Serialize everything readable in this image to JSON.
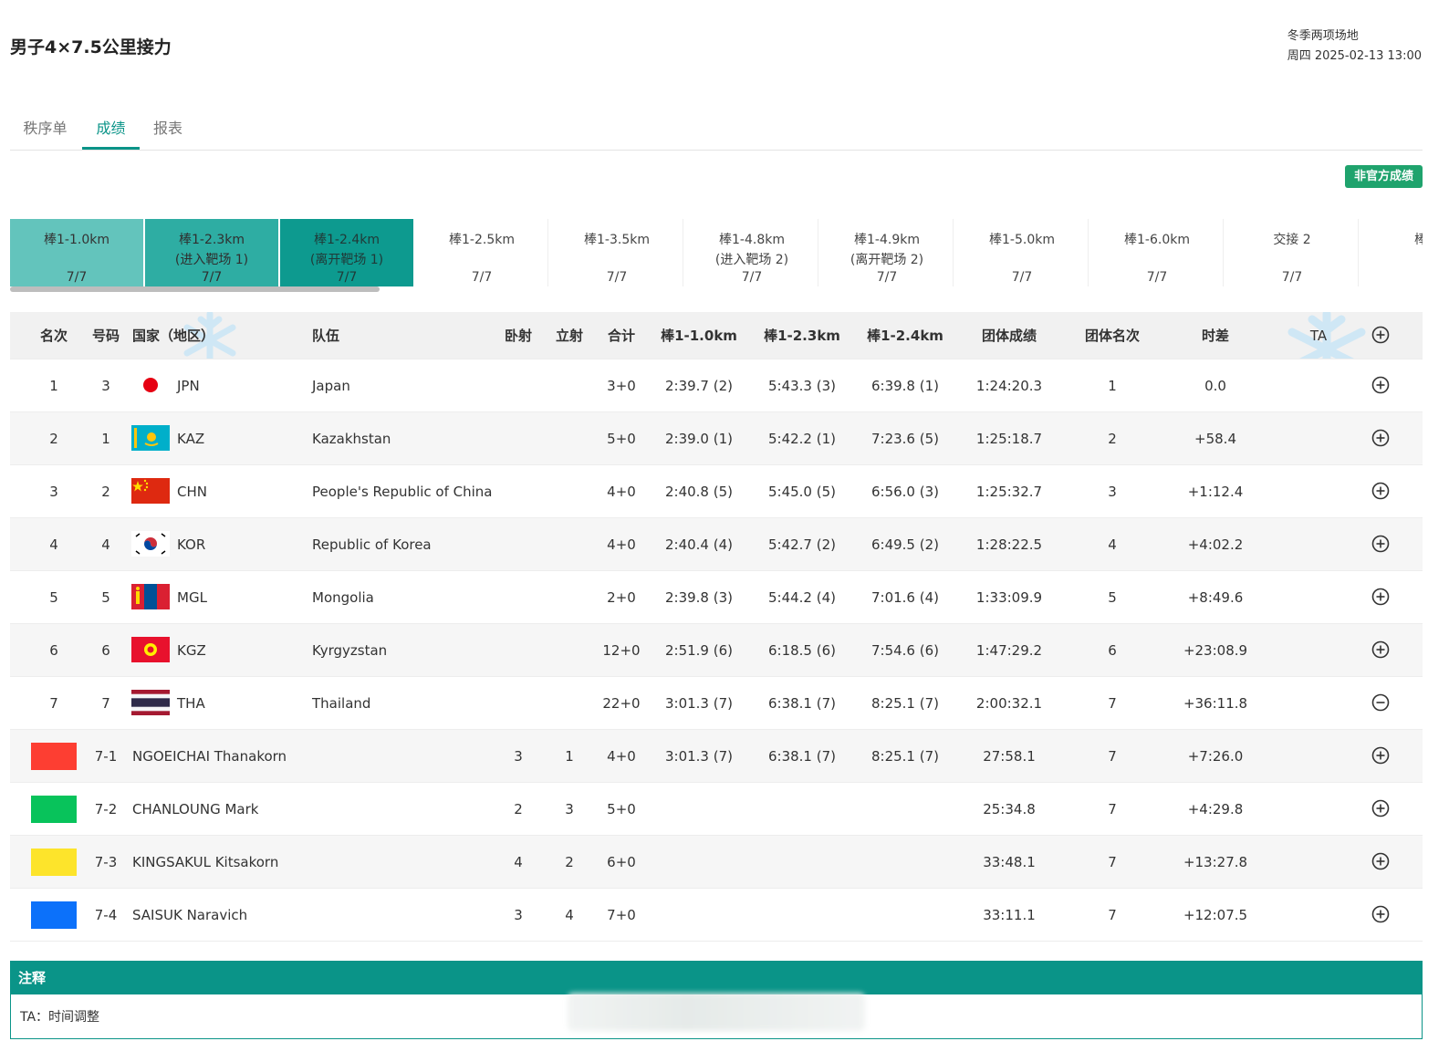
{
  "page": {
    "title": "男子4×7.5公里接力",
    "venue": "冬季两项场地",
    "datetime": "周四 2025-02-13 13:00"
  },
  "tabs": [
    {
      "label": "秩序单"
    },
    {
      "label": "成绩"
    },
    {
      "label": "报表"
    }
  ],
  "active_tab": "成绩",
  "badge": "非官方成绩",
  "splits": [
    {
      "label": "棒1-1.0km",
      "sub": "",
      "count": "7/7"
    },
    {
      "label": "棒1-2.3km",
      "sub": "(进入靶场 1)",
      "count": "7/7"
    },
    {
      "label": "棒1-2.4km",
      "sub": "(离开靶场 1)",
      "count": "7/7"
    },
    {
      "label": "棒1-2.5km",
      "sub": "",
      "count": "7/7"
    },
    {
      "label": "棒1-3.5km",
      "sub": "",
      "count": "7/7"
    },
    {
      "label": "棒1-4.8km",
      "sub": "(进入靶场 2)",
      "count": "7/7"
    },
    {
      "label": "棒1-4.9km",
      "sub": "(离开靶场 2)",
      "count": "7/7"
    },
    {
      "label": "棒1-5.0km",
      "sub": "",
      "count": "7/7"
    },
    {
      "label": "棒1-6.0km",
      "sub": "",
      "count": "7/7"
    },
    {
      "label": "交接 2",
      "sub": "",
      "count": "7/7"
    },
    {
      "label": "棒2-",
      "sub": "",
      "count": "7"
    }
  ],
  "columns": {
    "rank": "名次",
    "bib": "号码",
    "noc": "国家（地区）",
    "team": "队伍",
    "prone": "卧射",
    "standing": "立射",
    "total": "合计",
    "s1": "棒1-1.0km",
    "s2": "棒1-2.3km",
    "s3": "棒1-2.4km",
    "team_result": "团体成绩",
    "team_rank": "团体名次",
    "behind": "时差",
    "ta": "TA"
  },
  "teams": [
    {
      "rank": "1",
      "bib": "3",
      "noc": "JPN",
      "team": "Japan",
      "total": "3+0",
      "s1": "2:39.7 (2)",
      "s2": "5:43.3 (3)",
      "s3": "6:39.8 (1)",
      "result": "1:24:20.3",
      "team_rank": "1",
      "behind": "0.0",
      "expanded": false
    },
    {
      "rank": "2",
      "bib": "1",
      "noc": "KAZ",
      "team": "Kazakhstan",
      "total": "5+0",
      "s1": "2:39.0 (1)",
      "s2": "5:42.2 (1)",
      "s3": "7:23.6 (5)",
      "result": "1:25:18.7",
      "team_rank": "2",
      "behind": "+58.4",
      "expanded": false
    },
    {
      "rank": "3",
      "bib": "2",
      "noc": "CHN",
      "team": "People's Republic of China",
      "total": "4+0",
      "s1": "2:40.8 (5)",
      "s2": "5:45.0 (5)",
      "s3": "6:56.0 (3)",
      "result": "1:25:32.7",
      "team_rank": "3",
      "behind": "+1:12.4",
      "expanded": false
    },
    {
      "rank": "4",
      "bib": "4",
      "noc": "KOR",
      "team": "Republic of Korea",
      "total": "4+0",
      "s1": "2:40.4 (4)",
      "s2": "5:42.7 (2)",
      "s3": "6:49.5 (2)",
      "result": "1:28:22.5",
      "team_rank": "4",
      "behind": "+4:02.2",
      "expanded": false
    },
    {
      "rank": "5",
      "bib": "5",
      "noc": "MGL",
      "team": "Mongolia",
      "total": "2+0",
      "s1": "2:39.8 (3)",
      "s2": "5:44.2 (4)",
      "s3": "7:01.6 (4)",
      "result": "1:33:09.9",
      "team_rank": "5",
      "behind": "+8:49.6",
      "expanded": false
    },
    {
      "rank": "6",
      "bib": "6",
      "noc": "KGZ",
      "team": "Kyrgyzstan",
      "total": "12+0",
      "s1": "2:51.9 (6)",
      "s2": "6:18.5 (6)",
      "s3": "7:54.6 (6)",
      "result": "1:47:29.2",
      "team_rank": "6",
      "behind": "+23:08.9",
      "expanded": false
    },
    {
      "rank": "7",
      "bib": "7",
      "noc": "THA",
      "team": "Thailand",
      "total": "22+0",
      "s1": "3:01.3 (7)",
      "s2": "6:38.1 (7)",
      "s3": "8:25.1 (7)",
      "result": "2:00:32.1",
      "team_rank": "7",
      "behind": "+36:11.8",
      "expanded": true
    }
  ],
  "athletes": [
    {
      "color": "#fd3e32",
      "bib": "7-1",
      "name": "NGOEICHAI Thanakorn",
      "prone": "3",
      "standing": "1",
      "total": "4+0",
      "s1": "3:01.3 (7)",
      "s2": "6:38.1 (7)",
      "s3": "8:25.1 (7)",
      "result": "27:58.1",
      "team_rank": "7",
      "behind": "+7:26.0"
    },
    {
      "color": "#08c35b",
      "bib": "7-2",
      "name": "CHANLOUNG Mark",
      "prone": "2",
      "standing": "3",
      "total": "5+0",
      "s1": "",
      "s2": "",
      "s3": "",
      "result": "25:34.8",
      "team_rank": "7",
      "behind": "+4:29.8"
    },
    {
      "color": "#fde42b",
      "bib": "7-3",
      "name": "KINGSAKUL Kitsakorn",
      "prone": "4",
      "standing": "2",
      "total": "6+0",
      "s1": "",
      "s2": "",
      "s3": "",
      "result": "33:48.1",
      "team_rank": "7",
      "behind": "+13:27.8"
    },
    {
      "color": "#0c71fa",
      "bib": "7-4",
      "name": "SAISUK Naravich",
      "prone": "3",
      "standing": "4",
      "total": "7+0",
      "s1": "",
      "s2": "",
      "s3": "",
      "result": "33:11.1",
      "team_rank": "7",
      "behind": "+12:07.5"
    }
  ],
  "notes": {
    "title": "注释",
    "text": "TA：时间调整"
  },
  "colors": {
    "accent": "#0a9488",
    "badge": "#1fa36d",
    "split_sel_1": "#63c4bc",
    "split_sel_2": "#2eada3",
    "split_sel_3": "#0d9a8f"
  },
  "icons": {
    "expand": "plus-circle-icon",
    "collapse": "minus-circle-icon",
    "watermark": "snowflake-icon"
  }
}
